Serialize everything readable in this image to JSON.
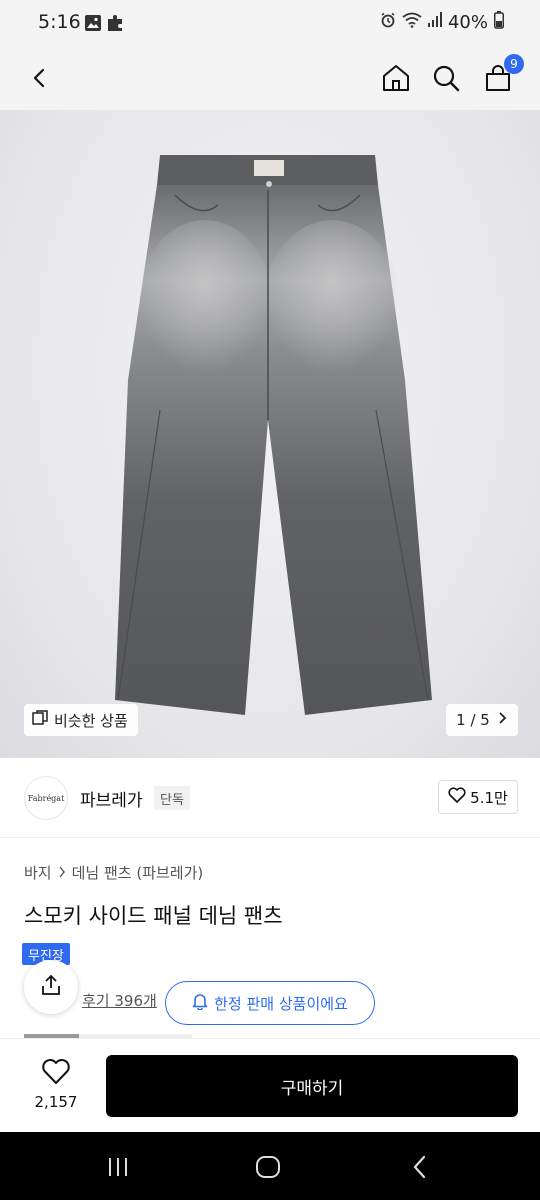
{
  "status_bar": {
    "time": "5:16",
    "battery": "40%",
    "left_icons": [
      "gallery-icon",
      "puzzle-icon"
    ],
    "right_icons": [
      "alarm-icon",
      "wifi-icon",
      "signal-icon",
      "battery-icon"
    ]
  },
  "header": {
    "icons": [
      "back-arrow-icon",
      "home-icon",
      "search-icon",
      "cart-icon"
    ],
    "cart_count": "9"
  },
  "gallery": {
    "similar_label": "비슷한 상품",
    "pager_text": "1 / 5",
    "current_page": 1,
    "total_pages": 5
  },
  "brand": {
    "logo_text": "Fabrégat",
    "name": "파브레가",
    "exclusive_badge": "단독",
    "likes": "5.1만"
  },
  "product": {
    "breadcrumb": [
      "바지",
      "데님 팬츠 (파브레가)"
    ],
    "title": "스모키 사이드 패널 데님 팬츠",
    "free_shipping_badge": "무진장",
    "review_text": "후기 396개"
  },
  "toast": {
    "text": "한정 판매 상품이에요"
  },
  "bottom_bar": {
    "wish_count": "2,157",
    "buy_label": "구매하기"
  },
  "colors": {
    "accent_blue": "#2f6bf2",
    "buy_button": "#000000",
    "nav_bar": "#000000"
  }
}
